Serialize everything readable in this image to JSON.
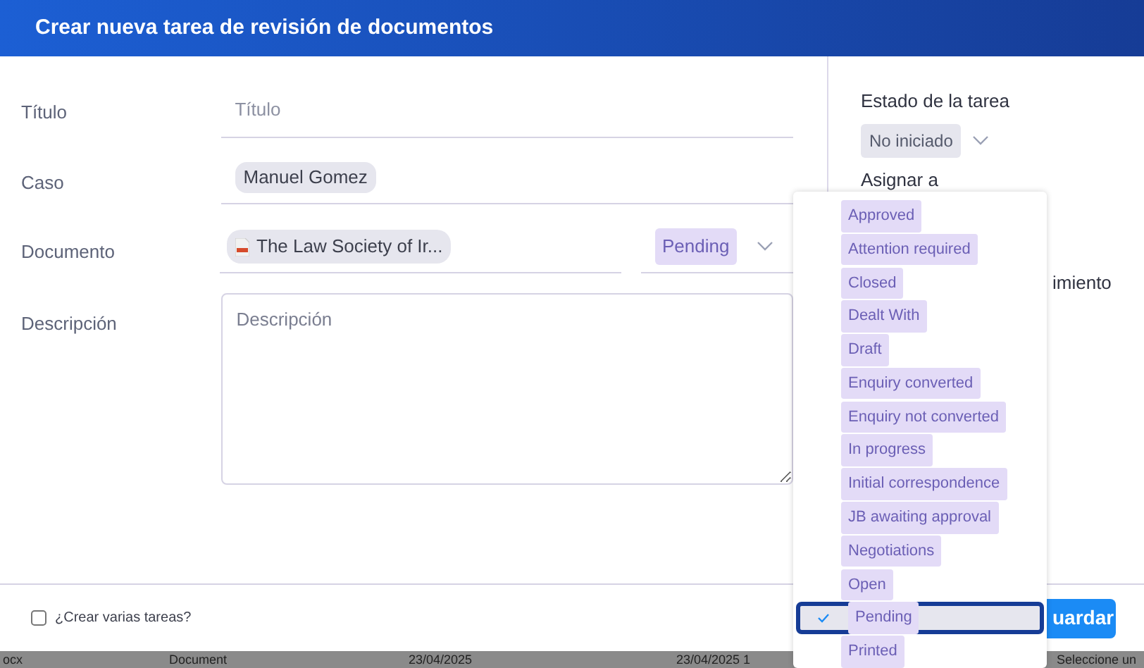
{
  "dialog": {
    "title": "Crear nueva tarea de revisión de documentos"
  },
  "form": [
    {
      "kind": "text",
      "label": "Título",
      "placeholder": "Título"
    },
    {
      "kind": "chip",
      "label": "Caso",
      "value": "Manuel Gomez"
    },
    {
      "kind": "document",
      "label": "Documento",
      "value": "The Law Society of Ir...",
      "status": "Pending"
    },
    {
      "kind": "textarea",
      "label": "Descripción",
      "placeholder": "Descripción"
    }
  ],
  "side_panel": {
    "status_label": "Estado de la tarea",
    "status_value": "No iniciado",
    "assign_label": "Asignar a",
    "partial_label": "imiento"
  },
  "footer": {
    "multiple_checkbox": {
      "label": "¿Crear varias tareas?",
      "checked": false
    },
    "save_button": "uardar"
  },
  "status_dropdown": [
    {
      "label": "Approved",
      "selected": false
    },
    {
      "label": "Attention required",
      "selected": false
    },
    {
      "label": "Closed",
      "selected": false
    },
    {
      "label": "Dealt With",
      "selected": false
    },
    {
      "label": "Draft",
      "selected": false
    },
    {
      "label": "Enquiry converted",
      "selected": false
    },
    {
      "label": "Enquiry not converted",
      "selected": false
    },
    {
      "label": "In progress",
      "selected": false
    },
    {
      "label": "Initial correspondence",
      "selected": false
    },
    {
      "label": "JB awaiting approval",
      "selected": false
    },
    {
      "label": "Negotiations",
      "selected": false
    },
    {
      "label": "Open",
      "selected": false
    },
    {
      "label": "Pending",
      "selected": true
    },
    {
      "label": "Printed",
      "selected": false
    }
  ],
  "background_row": [
    "ocx",
    "Document",
    "23/04/2025",
    "23/04/2025 1",
    "Seleccione un"
  ]
}
